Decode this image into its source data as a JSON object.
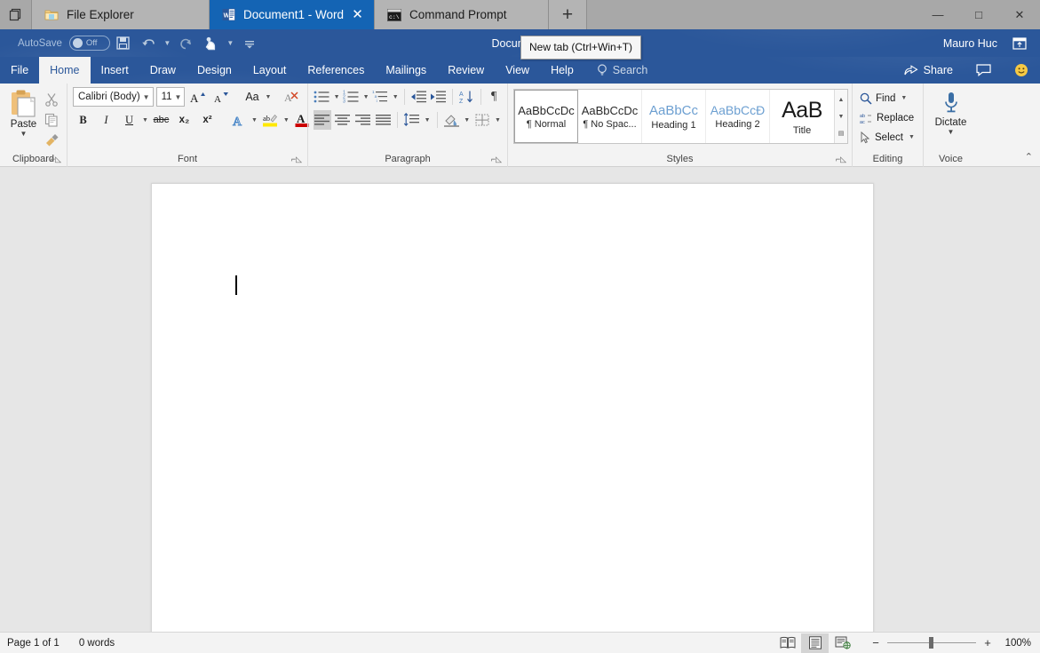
{
  "window": {
    "sets_tabs": [
      {
        "label": "File Explorer",
        "icon": "folder-icon",
        "active": false
      },
      {
        "label": "Document1 - Word",
        "icon": "word-icon",
        "active": true
      },
      {
        "label": "Command Prompt",
        "icon": "console-icon",
        "active": false
      }
    ],
    "new_tab_glyph": "+",
    "tab_close_glyph": "✕",
    "controls": {
      "minimize": "—",
      "maximize": "□",
      "close": "✕"
    }
  },
  "tooltip": {
    "text": "New tab (Ctrl+Win+T)"
  },
  "titlebar": {
    "autosave_label": "AutoSave",
    "autosave_state": "Off",
    "document_title": "Document1",
    "user_name": "Mauro Huc",
    "qat": [
      "save-icon",
      "undo-icon",
      "redo-icon",
      "touch-mode-icon",
      "customize-qat-icon"
    ]
  },
  "ribbon_tabs": {
    "items": [
      "File",
      "Home",
      "Insert",
      "Draw",
      "Design",
      "Layout",
      "References",
      "Mailings",
      "Review",
      "View",
      "Help"
    ],
    "active": "Home",
    "search_label": "Search",
    "share_label": "Share"
  },
  "ribbon": {
    "clipboard": {
      "group_label": "Clipboard",
      "paste_label": "Paste",
      "cut_name": "cut-icon",
      "copy_name": "copy-icon",
      "format_painter_name": "format-painter-icon"
    },
    "font": {
      "group_label": "Font",
      "font_name": "Calibri (Body)",
      "font_size": "11",
      "grow_font": "A",
      "shrink_font": "A",
      "change_case": "Aa",
      "clear_formatting": "clear-formatting-icon",
      "bold": "B",
      "italic": "I",
      "underline": "U",
      "strikethrough": "abc",
      "subscript": "x₂",
      "superscript": "x²",
      "text_effects": "A",
      "highlight": "ab",
      "font_color": "A"
    },
    "paragraph": {
      "group_label": "Paragraph",
      "buttons_row1": [
        "bullets",
        "numbering",
        "multilevel-list",
        "decrease-indent",
        "increase-indent",
        "sort",
        "show-marks"
      ],
      "buttons_row2": [
        "align-left",
        "align-center",
        "align-right",
        "justify",
        "line-spacing",
        "shading",
        "borders"
      ]
    },
    "styles": {
      "group_label": "Styles",
      "items": [
        {
          "preview": "AaBbCcDc",
          "name": "¶ Normal",
          "selected": true
        },
        {
          "preview": "AaBbCcDc",
          "name": "¶ No Spac...",
          "selected": false
        },
        {
          "preview": "AaBbCс",
          "name": "Heading 1",
          "selected": false
        },
        {
          "preview": "AaBbCcĐ",
          "name": "Heading 2",
          "selected": false
        },
        {
          "preview": "AaB",
          "name": "Title",
          "selected": false
        }
      ]
    },
    "editing": {
      "group_label": "Editing",
      "find": "Find",
      "replace": "Replace",
      "select": "Select"
    },
    "voice": {
      "group_label": "Voice",
      "dictate": "Dictate"
    }
  },
  "statusbar": {
    "page_info": "Page 1 of 1",
    "word_count": "0 words",
    "views": [
      "read-mode-icon",
      "print-layout-icon",
      "web-layout-icon"
    ],
    "active_view": "print-layout-icon",
    "zoom_out": "−",
    "zoom_in": "+",
    "zoom_level": "100%"
  },
  "colors": {
    "word_blue": "#2b579a",
    "sets_active_tab": "#1464b4",
    "ribbon_bg": "#f3f3f3",
    "doc_bg": "#e6e6e6"
  }
}
